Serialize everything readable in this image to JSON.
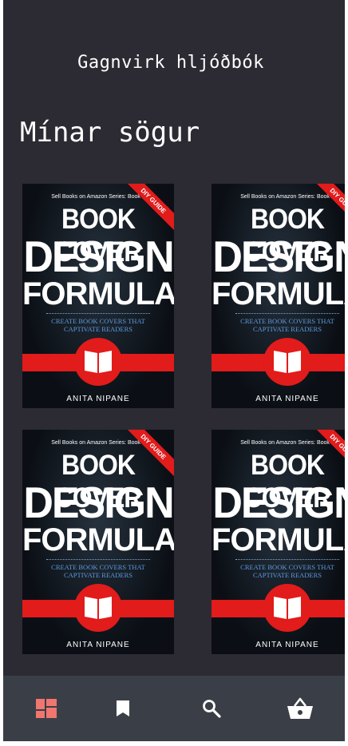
{
  "app_title": "Gagnvirk hljóðbók",
  "section_title": "Mínar sögur",
  "book": {
    "series": "Sell Books on Amazon Series: Book 1",
    "ribbon": "DIY GUIDE",
    "title_line1": "BOOK COVER",
    "title_line2": "DESIGN",
    "title_line3": "FORMULA",
    "subtitle_line1": "CREATE BOOK COVERS THAT",
    "subtitle_line2": "CAPTIVATE READERS",
    "author": "ANITA NIPANE"
  },
  "nav": {
    "items": [
      {
        "icon": "dashboard-icon",
        "active": true
      },
      {
        "icon": "bookmark-icon",
        "active": false
      },
      {
        "icon": "search-icon",
        "active": false
      },
      {
        "icon": "basket-icon",
        "active": false
      }
    ]
  },
  "colors": {
    "background": "#2c2b33",
    "nav_bar": "#3a3f47",
    "accent": "#f0766f",
    "cover_red": "#e21b1b"
  }
}
